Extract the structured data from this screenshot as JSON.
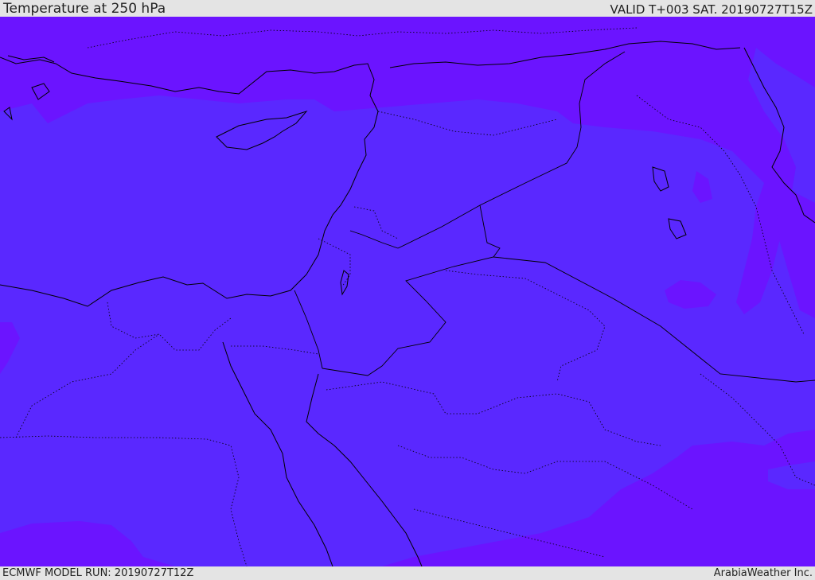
{
  "header": {
    "title": "Temperature at 250 hPa",
    "valid": "VALID T+003 SAT. 20190727T15Z"
  },
  "footer": {
    "model_run": "ECMWF MODEL RUN: 20190727T12Z",
    "credit": "ArabiaWeather Inc."
  },
  "map": {
    "field": "temperature-250hpa",
    "colors": {
      "base_fill": "#5a28ff",
      "warm_band": "#6b14ff",
      "coastline": "#000000",
      "border": "#000000"
    }
  }
}
